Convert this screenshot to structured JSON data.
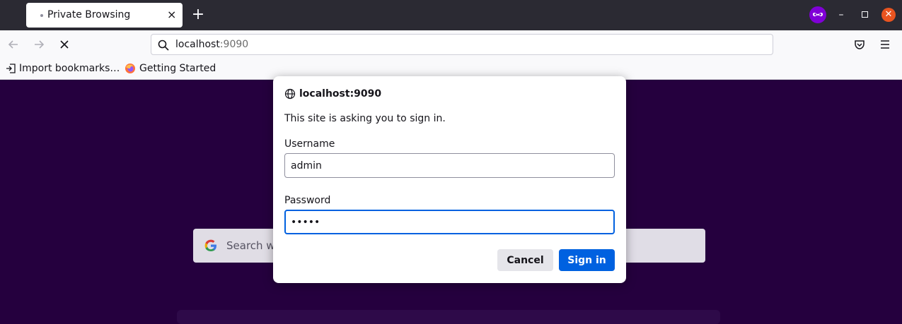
{
  "browser": {
    "tab_title": "Private Browsing",
    "tab_close_glyph": "×",
    "new_tab_glyph": "+",
    "window_min_glyph": "–",
    "window_close_glyph": "✕",
    "private_icon": "private-browsing-mask-icon",
    "url_host": "localhost",
    "url_port": ":9090",
    "bookmarks": [
      {
        "label": "Import bookmarks…",
        "icon": "import-icon"
      },
      {
        "label": "Getting Started",
        "icon": "firefox-icon"
      }
    ]
  },
  "page": {
    "search_placeholder": "Search wi"
  },
  "auth_dialog": {
    "title": "localhost:9090",
    "message": "This site is asking you to sign in.",
    "username_label": "Username",
    "username_value": "admin",
    "password_label": "Password",
    "password_value": "•••••",
    "cancel_label": "Cancel",
    "signin_label": "Sign in"
  },
  "colors": {
    "accent": "#0061e0",
    "page_bg": "#25003e",
    "private_purple": "#8000d7",
    "close_orange": "#e95420"
  }
}
